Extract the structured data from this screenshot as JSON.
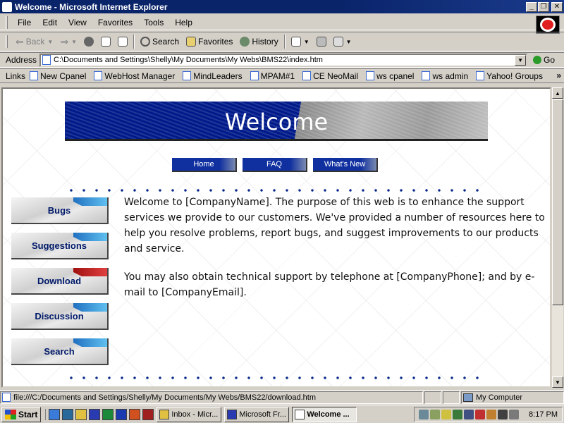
{
  "window": {
    "title": "Welcome - Microsoft Internet Explorer",
    "minimize": "_",
    "restore": "❐",
    "close": "✕"
  },
  "menu": [
    "File",
    "Edit",
    "View",
    "Favorites",
    "Tools",
    "Help"
  ],
  "toolbar": {
    "back": "Back",
    "search": "Search",
    "favorites": "Favorites",
    "history": "History"
  },
  "address": {
    "label": "Address",
    "value": "C:\\Documents and Settings\\Shelly\\My Documents\\My Webs\\BMS22\\index.htm",
    "go": "Go"
  },
  "links": {
    "label": "Links",
    "more": "»",
    "items": [
      "New Cpanel",
      "WebHost Manager",
      "MindLeaders",
      "MPAM#1",
      "CE NeoMail",
      "ws cpanel",
      "ws admin",
      "Yahoo! Groups"
    ]
  },
  "page": {
    "banner_title": "Welcome",
    "nav": [
      "Home",
      "FAQ",
      "What's New"
    ],
    "sidebar": [
      "Bugs",
      "Suggestions",
      "Download",
      "Discussion",
      "Search"
    ],
    "paragraphs": [
      "Welcome to [CompanyName]. The purpose of this web is to enhance the support services we provide to our customers. We've provided a number of resources here to help you resolve problems, report bugs, and suggest improvements to our products and service.",
      "You may also obtain technical support by telephone at [CompanyPhone]; and by e-mail to [CompanyEmail]."
    ]
  },
  "status": {
    "text": "file:///C:/Documents and Settings/Shelly/My Documents/My Webs/BMS22/download.htm",
    "zone": "My Computer"
  },
  "taskbar": {
    "start": "Start",
    "tasks": [
      "Inbox - Micr...",
      "Microsoft Fr...",
      "Welcome ..."
    ],
    "clock": "8:17 PM"
  }
}
